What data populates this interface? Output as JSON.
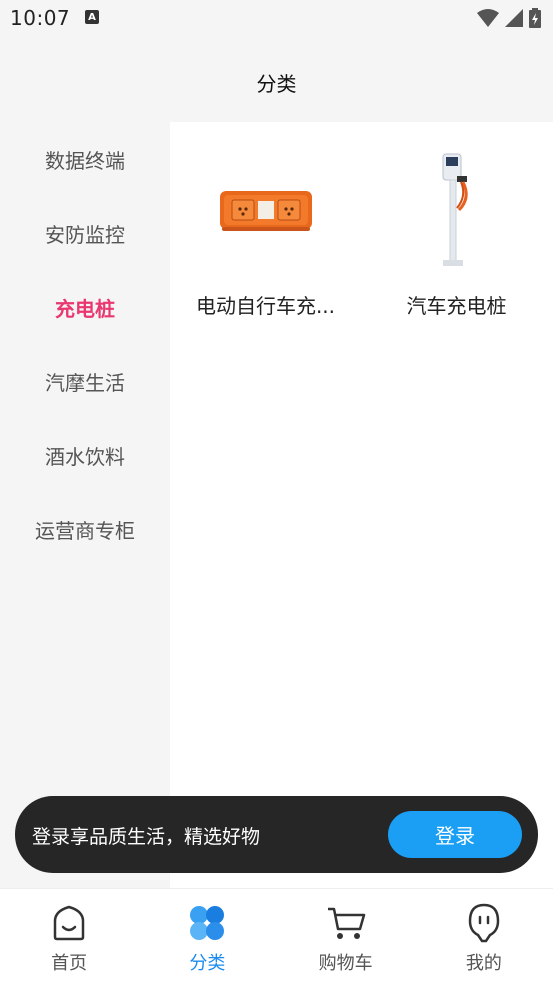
{
  "status": {
    "time": "10:07",
    "a_badge": "A"
  },
  "header": {
    "title": "分类"
  },
  "sidebar": {
    "items": [
      {
        "label": "数据终端",
        "active": false
      },
      {
        "label": "安防监控",
        "active": false
      },
      {
        "label": "充电桩",
        "active": true
      },
      {
        "label": "汽摩生活",
        "active": false
      },
      {
        "label": "酒水饮料",
        "active": false
      },
      {
        "label": "运营商专柜",
        "active": false
      }
    ]
  },
  "products": [
    {
      "name": "电动自行车充...",
      "image": "ebike-charger"
    },
    {
      "name": "汽车充电桩",
      "image": "car-charging-pile"
    }
  ],
  "login_banner": {
    "text": "登录享品质生活，精选好物",
    "button": "登录"
  },
  "bottom_nav": {
    "items": [
      {
        "label": "首页",
        "icon": "home-icon"
      },
      {
        "label": "分类",
        "icon": "category-icon"
      },
      {
        "label": "购物车",
        "icon": "cart-icon"
      },
      {
        "label": "我的",
        "icon": "profile-icon"
      }
    ],
    "active": "分类"
  },
  "colors": {
    "accent": "#e8386f",
    "primary": "#1a9ff5",
    "banner_bg": "#262626"
  }
}
